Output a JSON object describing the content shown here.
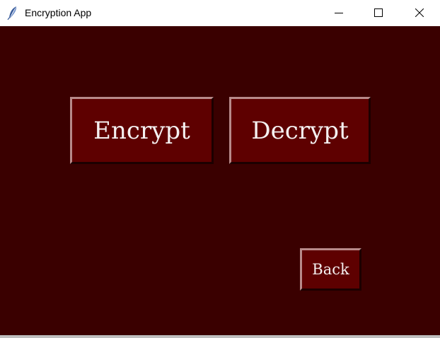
{
  "window": {
    "title": "Encryption App",
    "icon": "feather-icon"
  },
  "controls": {
    "minimize_icon": "minimize-icon",
    "maximize_icon": "maximize-icon",
    "close_icon": "close-icon"
  },
  "buttons": {
    "encrypt_label": "Encrypt",
    "decrypt_label": "Decrypt",
    "back_label": "Back"
  },
  "colors": {
    "background": "#3a0000",
    "button_face": "#5e0000",
    "button_text": "#f4f0f0"
  }
}
